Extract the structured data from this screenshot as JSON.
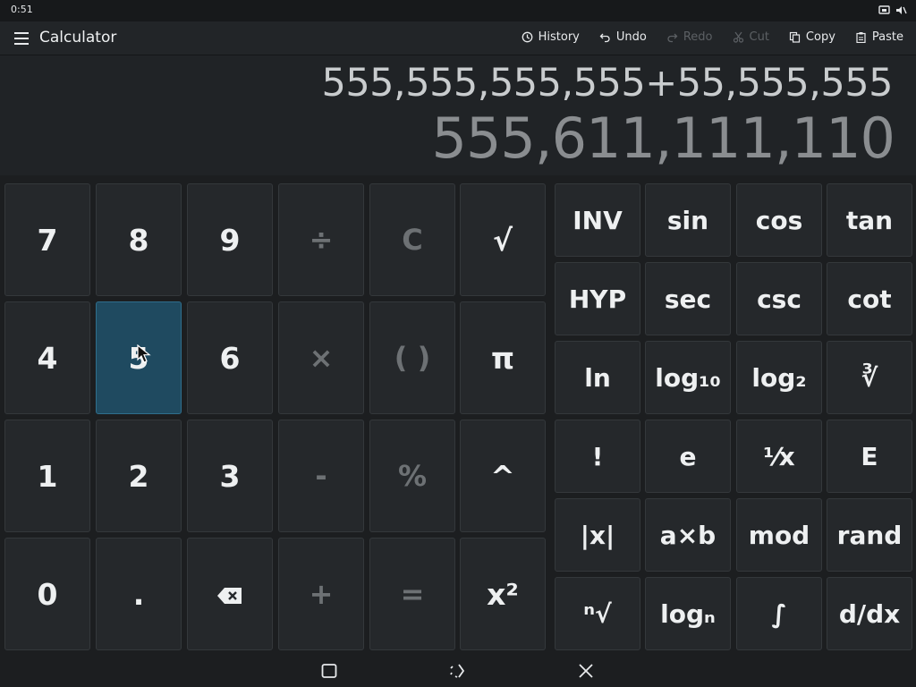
{
  "status": {
    "time": "0:51",
    "icons": [
      "screen-rotation-icon",
      "mute-icon"
    ]
  },
  "toolbar": {
    "menu_icon": "hamburger-menu-icon",
    "title": "Calculator",
    "actions": [
      {
        "label": "History",
        "icon": "history-icon",
        "enabled": true
      },
      {
        "label": "Undo",
        "icon": "undo-icon",
        "enabled": true
      },
      {
        "label": "Redo",
        "icon": "redo-icon",
        "enabled": false
      },
      {
        "label": "Cut",
        "icon": "cut-icon",
        "enabled": false
      },
      {
        "label": "Copy",
        "icon": "copy-icon",
        "enabled": true
      },
      {
        "label": "Paste",
        "icon": "paste-icon",
        "enabled": true
      }
    ]
  },
  "display": {
    "expression": "555,555,555,555+55,555,555",
    "result": "555,611,111,110"
  },
  "keypad": {
    "basic": [
      [
        "7",
        "8",
        "9",
        "÷",
        "C",
        "√"
      ],
      [
        "4",
        "5",
        "6",
        "×",
        "( )",
        "π"
      ],
      [
        "1",
        "2",
        "3",
        "-",
        "%",
        "^"
      ],
      [
        "0",
        ".",
        "backspace",
        "+",
        "=",
        "x²"
      ]
    ],
    "scientific": [
      [
        "INV",
        "sin",
        "cos",
        "tan"
      ],
      [
        "HYP",
        "sec",
        "csc",
        "cot"
      ],
      [
        "ln",
        "log₁₀",
        "log₂",
        "∛"
      ],
      [
        "!",
        "e",
        "⅟x",
        "E"
      ],
      [
        "|x|",
        "a×b",
        "mod",
        "rand"
      ],
      [
        "ⁿ√",
        "logₙ",
        "∫",
        "d/dx"
      ]
    ],
    "pressed_key": "5"
  },
  "navbar": {
    "buttons": [
      "overview-icon",
      "rotate-icon",
      "close-icon"
    ]
  },
  "colors": {
    "background": "#1c1e20",
    "key": "#25282b",
    "key_border": "#34383b",
    "active_key": "#1f4a60",
    "result_text": "#8a8d90",
    "expression_text": "#c9ccce"
  }
}
